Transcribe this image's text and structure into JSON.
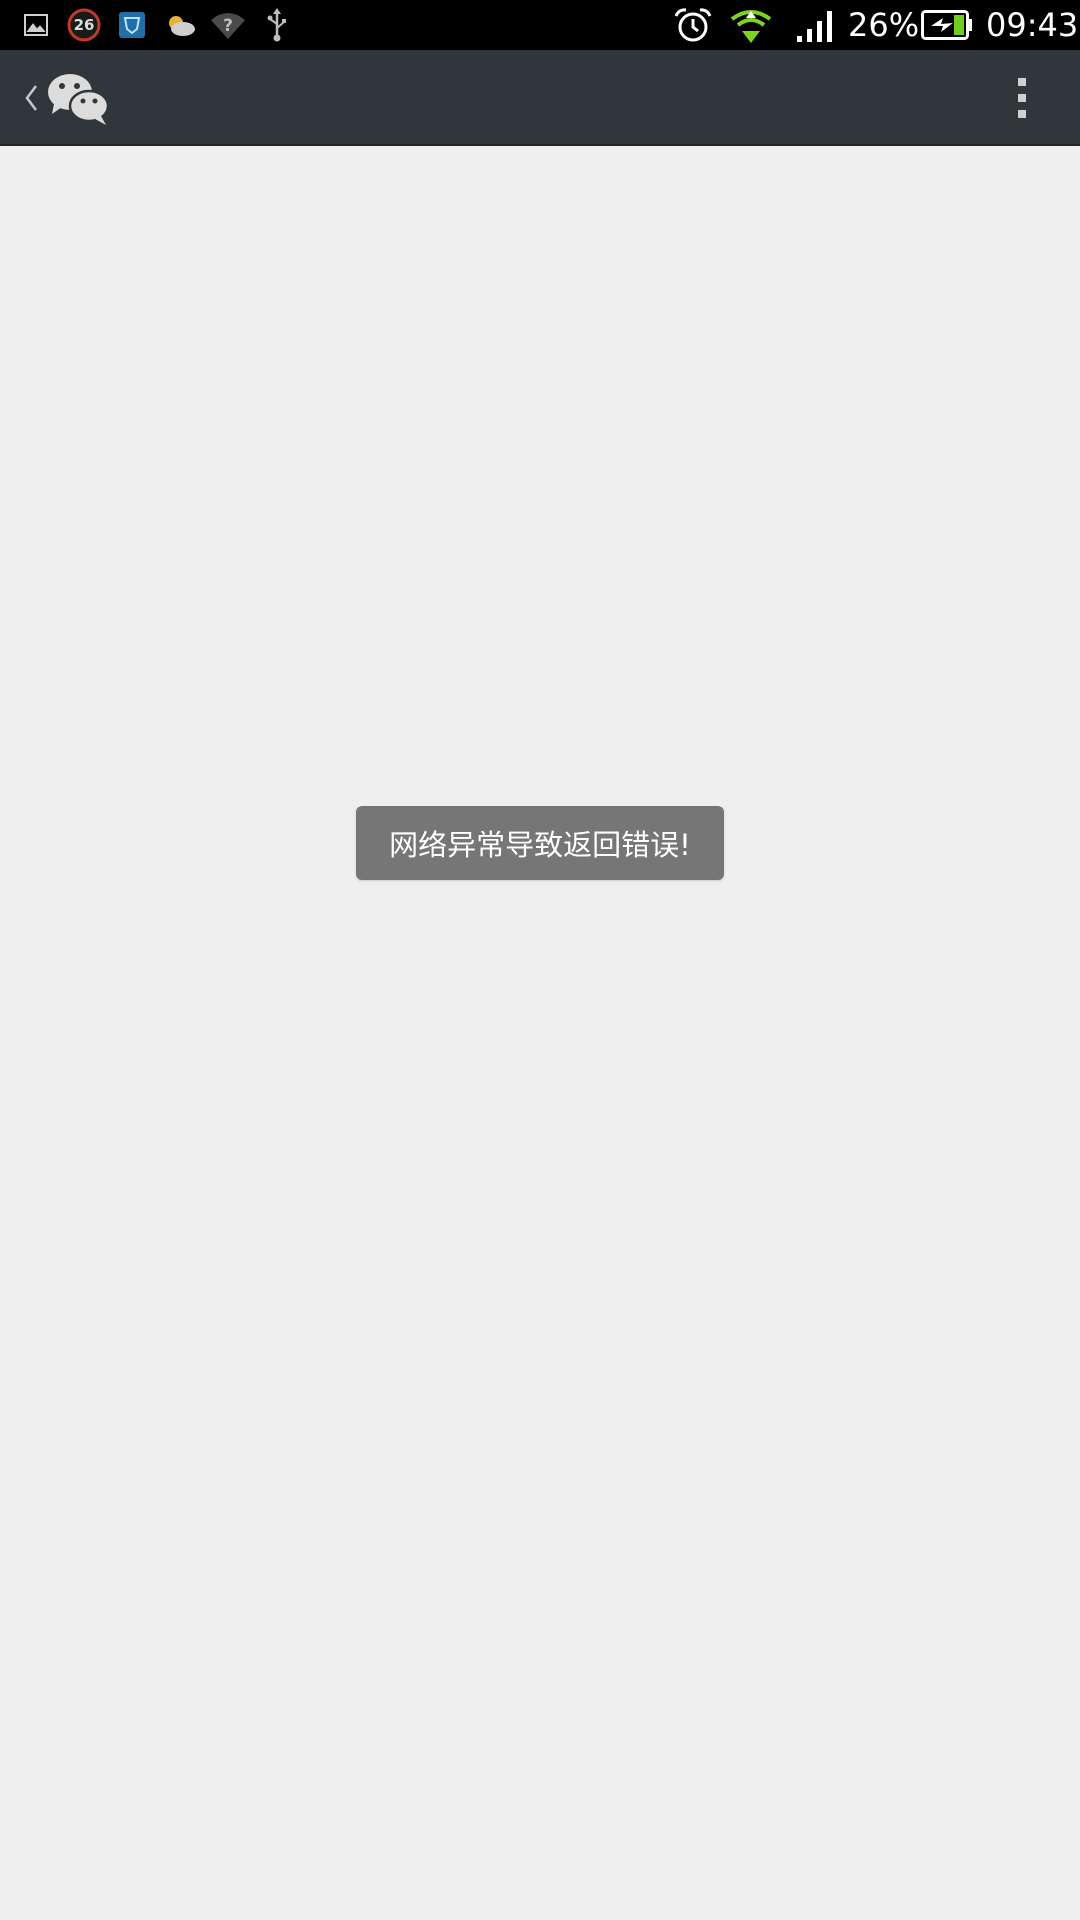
{
  "status_bar": {
    "notification_badge": "26",
    "battery_percent": "26%",
    "time": "09:43",
    "icons": [
      "gallery-icon",
      "counter-badge-icon",
      "shield-icon",
      "weather-icon",
      "wifi-unknown-icon",
      "usb-icon",
      "alarm-icon",
      "wifi-upload-icon",
      "signal-icon",
      "battery-charging-icon"
    ],
    "colors": {
      "background": "#000000",
      "wifi_active": "#7ed321",
      "battery_fill": "#6fcf1f"
    }
  },
  "action_bar": {
    "icons": [
      "back-chevron-icon",
      "wechat-logo-icon",
      "overflow-menu-icon"
    ],
    "background": "#30363a"
  },
  "toast": {
    "message": "网络异常导致返回错误!",
    "background": "#767676"
  },
  "content": {
    "background": "#efefef"
  }
}
